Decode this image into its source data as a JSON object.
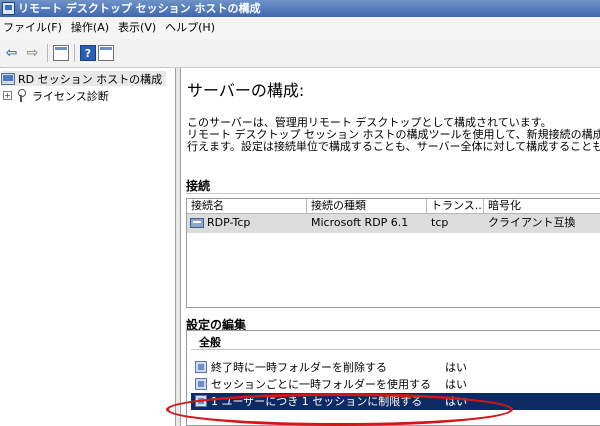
{
  "window": {
    "title": "リモート デスクトップ セッション ホストの構成"
  },
  "menu": {
    "items": [
      "ファイル(F)",
      "操作(A)",
      "表示(V)",
      "ヘルプ(H)"
    ]
  },
  "toolbar": {
    "icons": [
      "back-arrow-icon",
      "forward-arrow-icon",
      "console-tree-icon",
      "help-icon",
      "properties-icon"
    ]
  },
  "tree": {
    "root": "RD セッション ホストの構成",
    "child": "ライセンス診断",
    "child_expander": "+"
  },
  "main": {
    "title": "サーバーの構成:",
    "description": [
      "このサーバーは、管理用リモート デスクトップとして構成されています。",
      "リモート デスクトップ セッション ホストの構成ツールを使用して、新規接続の構成設定、既",
      "行えます。設定は接続単位で構成することも、サーバー全体に対して構成することもできま"
    ]
  },
  "connections": {
    "heading": "接続",
    "columns": [
      "接続名",
      "接続の種類",
      "トランス...",
      "暗号化"
    ],
    "rows": [
      {
        "name": "RDP-Tcp",
        "type": "Microsoft RDP 6.1",
        "transport": "tcp",
        "encryption": "クライアント互換"
      }
    ]
  },
  "settings": {
    "heading": "設定の編集",
    "group": "全般",
    "items": [
      {
        "label": "終了時に一時フォルダーを削除する",
        "value": "はい"
      },
      {
        "label": "セッションごとに一時フォルダーを使用する",
        "value": "はい"
      },
      {
        "label": "1 ユーザーにつき 1 セッションに制限する",
        "value": "はい",
        "selected": true
      }
    ]
  },
  "colors": {
    "selection": "#0c2b63",
    "annotation_ring": "#d41616",
    "titlebar": "#3f67ad"
  }
}
